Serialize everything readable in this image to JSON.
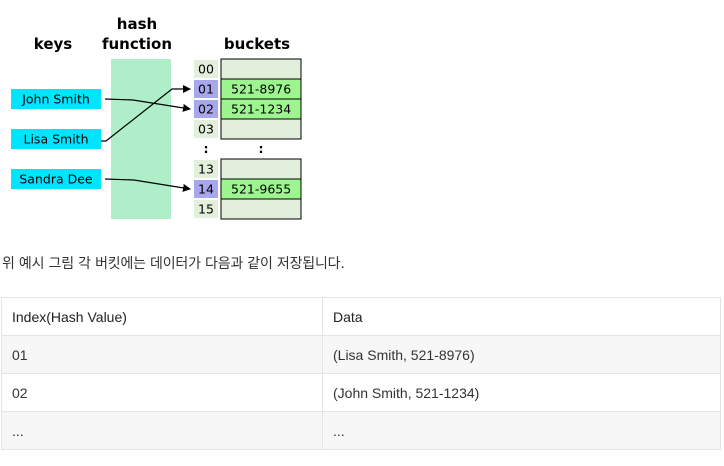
{
  "diagram": {
    "headers": {
      "keys": "keys",
      "hash_line1": "hash",
      "hash_line2": "function",
      "buckets": "buckets"
    },
    "keys": [
      "John Smith",
      "Lisa Smith",
      "Sandra Dee"
    ],
    "buckets": [
      {
        "index": "00",
        "value": "",
        "highlight": false
      },
      {
        "index": "01",
        "value": "521-8976",
        "highlight": true
      },
      {
        "index": "02",
        "value": "521-1234",
        "highlight": true
      },
      {
        "index": "03",
        "value": "",
        "highlight": false
      },
      {
        "index": ":",
        "value": ":",
        "highlight": false,
        "ellipsis": true
      },
      {
        "index": "13",
        "value": "",
        "highlight": false
      },
      {
        "index": "14",
        "value": "521-9655",
        "highlight": true
      },
      {
        "index": "15",
        "value": "",
        "highlight": false
      }
    ],
    "colors": {
      "key_box": "#00e5ff",
      "hash_band": "#aeeec9",
      "bucket_empty": "#e2efdb",
      "bucket_filled": "#9cf58e",
      "index_plain": "#e2efdb",
      "index_highlight": "#a7a7ee"
    }
  },
  "caption": "위 예시 그림 각 버킷에는 데이터가 다음과 같이 저장됩니다.",
  "table": {
    "headers": [
      "Index(Hash Value)",
      "Data"
    ],
    "rows": [
      [
        "01",
        "(Lisa Smith, 521-8976)"
      ],
      [
        "02",
        "(John Smith, 521-1234)"
      ],
      [
        "...",
        "..."
      ]
    ]
  }
}
